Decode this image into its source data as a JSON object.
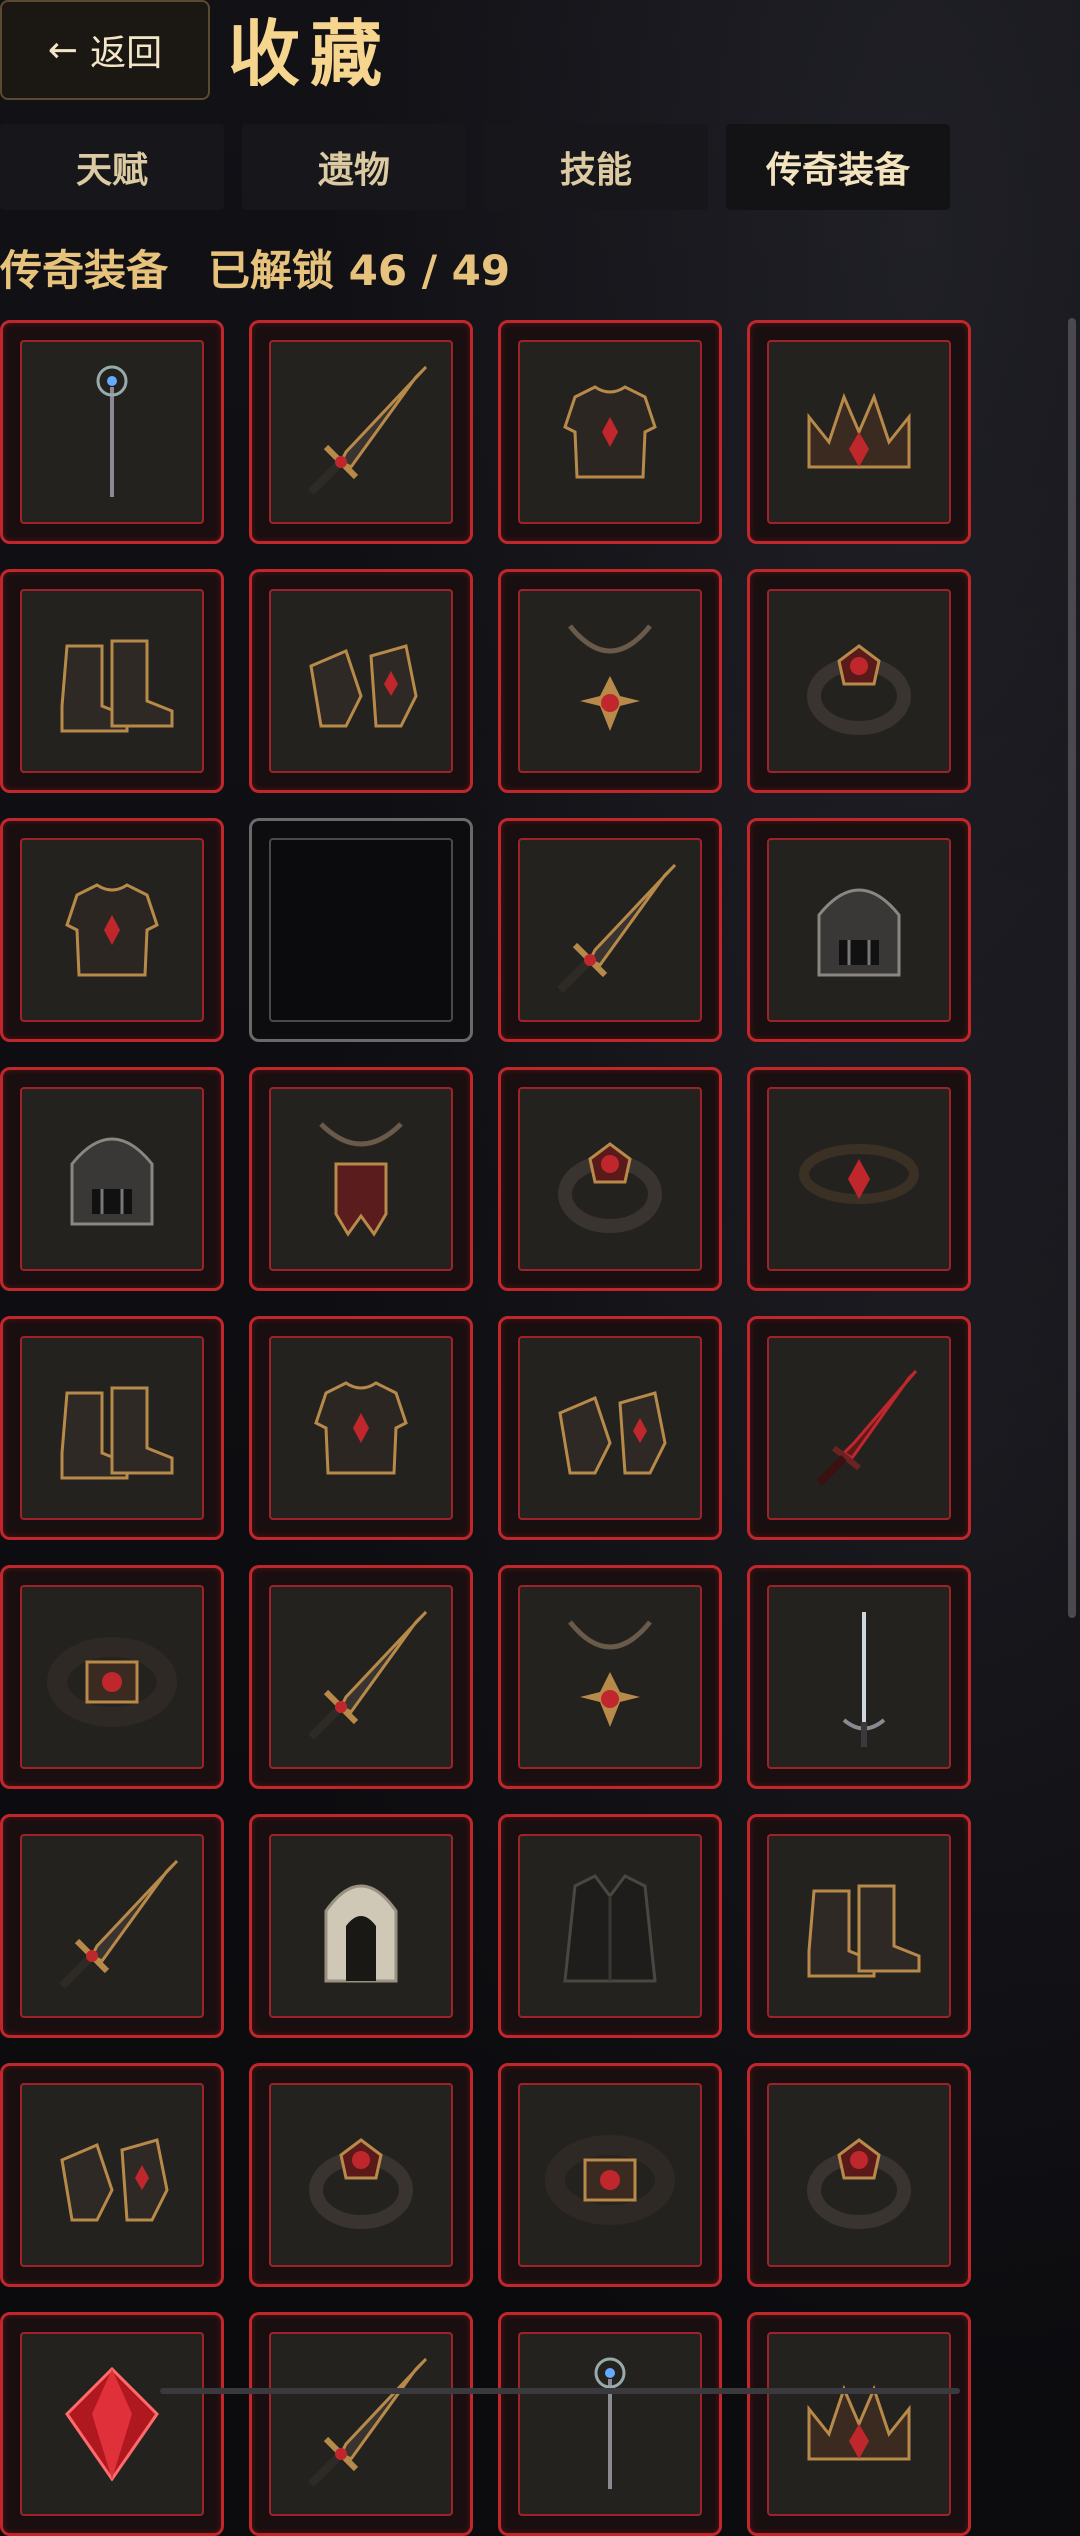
{
  "header": {
    "back_label": "返回",
    "back_icon": "left-arrow-icon",
    "title": "收藏"
  },
  "tabs": [
    {
      "label": "天赋",
      "active": false
    },
    {
      "label": "遗物",
      "active": false
    },
    {
      "label": "技能",
      "active": false
    },
    {
      "label": "传奇装备",
      "active": true
    }
  ],
  "section": {
    "name": "传奇装备",
    "unlocked_text": "已解锁 46 / 49"
  },
  "items": [
    "staff-icon",
    "sword-icon",
    "chest-armor-icon",
    "crown-icon",
    "boots-icon",
    "gauntlets-icon",
    "amulet-icon",
    "ring-icon",
    "chest-armor-icon",
    "locked-slot",
    "sword-icon",
    "helmet-icon",
    "helmet-icon",
    "banner-amulet-icon",
    "ring-icon",
    "thorn-crown-icon",
    "boots-icon",
    "chest-armor-icon",
    "gauntlets-icon",
    "dagger-icon",
    "belt-icon",
    "sword-icon",
    "amulet-icon",
    "rapier-icon",
    "sword-icon",
    "hood-icon",
    "coat-icon",
    "boots-icon",
    "gauntlets-icon",
    "ring-icon",
    "belt-icon",
    "ring-icon",
    "gem-icon",
    "sword-icon",
    "staff-icon",
    "crown-icon"
  ],
  "colors": {
    "accent": "#c0272d",
    "title": "#f6d58f",
    "locked_border": "#6a6a6a"
  }
}
